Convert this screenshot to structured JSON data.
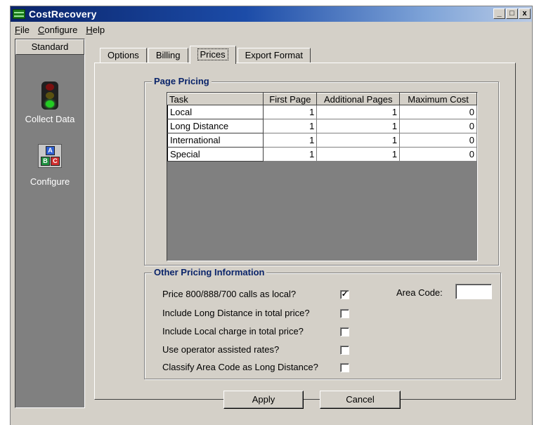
{
  "window": {
    "title": "CostRecovery",
    "controls": {
      "minimize": "_",
      "maximize": "□",
      "close": "x"
    }
  },
  "menu": [
    "File",
    "Configure",
    "Help"
  ],
  "sidebar": {
    "header": "Standard",
    "items": [
      {
        "label": "Collect Data",
        "icon": "traffic-light-icon"
      },
      {
        "label": "Configure",
        "icon": "abc-blocks-icon"
      }
    ]
  },
  "tabs": [
    "Options",
    "Billing",
    "Prices",
    "Export Format"
  ],
  "active_tab": "Prices",
  "page_pricing": {
    "title": "Page Pricing",
    "columns": [
      "Task",
      "First Page",
      "Additional Pages",
      "Maximum Cost"
    ],
    "rows": [
      {
        "task": "Local",
        "first": "1",
        "additional": "1",
        "max": "0"
      },
      {
        "task": "Long Distance",
        "first": "1",
        "additional": "1",
        "max": "0"
      },
      {
        "task": "International",
        "first": "1",
        "additional": "1",
        "max": "0"
      },
      {
        "task": "Special",
        "first": "1",
        "additional": "1",
        "max": "0"
      }
    ]
  },
  "other_pricing": {
    "title": "Other Pricing Information",
    "options": [
      {
        "label": "Price 800/888/700 calls as local?",
        "checked": true
      },
      {
        "label": "Include Long Distance in total price?",
        "checked": false
      },
      {
        "label": "Include Local charge in total price?",
        "checked": false
      },
      {
        "label": "Use operator assisted rates?",
        "checked": false
      },
      {
        "label": "Classify Area Code as Long Distance?",
        "checked": false
      }
    ],
    "area_code_label": "Area Code:",
    "area_code_value": ""
  },
  "buttons": {
    "apply": "Apply",
    "cancel": "Cancel"
  }
}
